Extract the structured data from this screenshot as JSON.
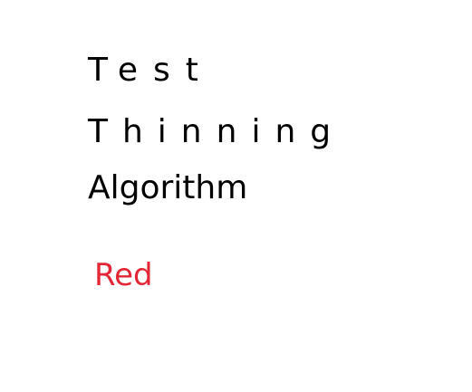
{
  "text_lines": {
    "line1": "Test",
    "line2": "Thinning",
    "line3": "Algorithm",
    "line4": "Red"
  },
  "colors": {
    "background": "#ffffff",
    "text": "#000000",
    "accent_red": "#e32636"
  }
}
